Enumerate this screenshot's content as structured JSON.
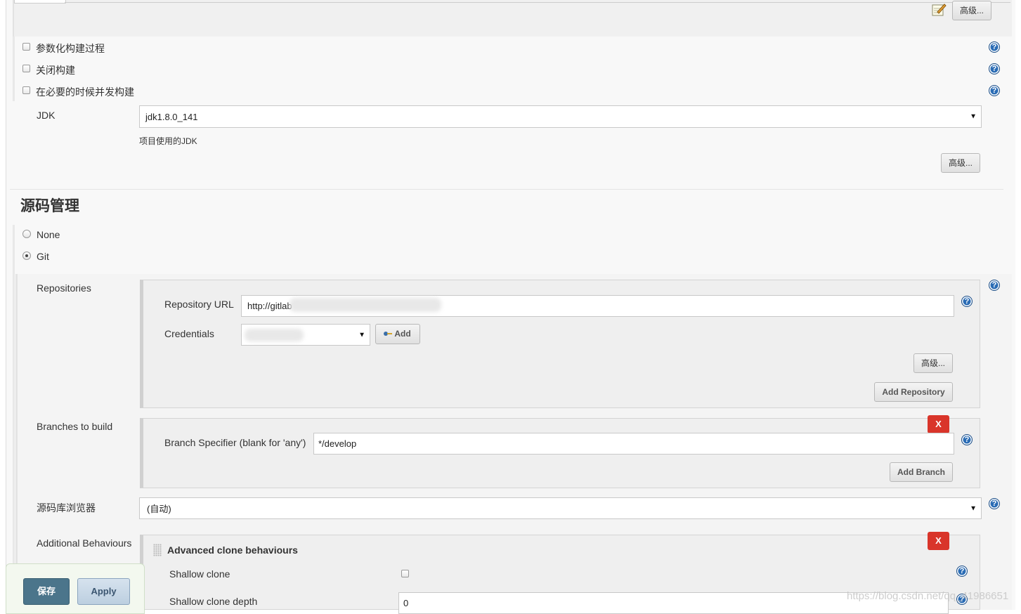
{
  "top": {
    "advanced_label": "高级...",
    "notepad_icon": "notepad-icon"
  },
  "options": [
    {
      "label": "参数化构建过程",
      "checked": false
    },
    {
      "label": "关闭构建",
      "checked": false
    },
    {
      "label": "在必要的时候并发构建",
      "checked": false
    }
  ],
  "jdk": {
    "label": "JDK",
    "value": "jdk1.8.0_141",
    "help_text": "项目使用的JDK",
    "advanced_label": "高级..."
  },
  "scm": {
    "title": "源码管理",
    "options": [
      {
        "label": "None",
        "selected": false
      },
      {
        "label": "Git",
        "selected": true
      }
    ],
    "repositories": {
      "label": "Repositories",
      "url_label": "Repository URL",
      "url_value": "http://gitlab",
      "credentials_label": "Credentials",
      "add_label": "Add",
      "advanced_label": "高级...",
      "add_repository_label": "Add Repository"
    },
    "branches": {
      "label": "Branches to build",
      "remove_label": "X",
      "specifier_label": "Branch Specifier (blank for 'any')",
      "specifier_value": "*/develop",
      "add_branch_label": "Add Branch"
    },
    "browser": {
      "label": "源码库浏览器",
      "value": "(自动)"
    },
    "behaviours": {
      "label": "Additional Behaviours",
      "remove_label": "X",
      "title": "Advanced clone behaviours",
      "shallow_clone_label": "Shallow clone",
      "shallow_clone_checked": false,
      "depth_label": "Shallow clone depth",
      "depth_value": "0"
    }
  },
  "footer": {
    "save_label": "保存",
    "apply_label": "Apply"
  },
  "watermark": "https://blog.csdn.net/qq_41986651"
}
